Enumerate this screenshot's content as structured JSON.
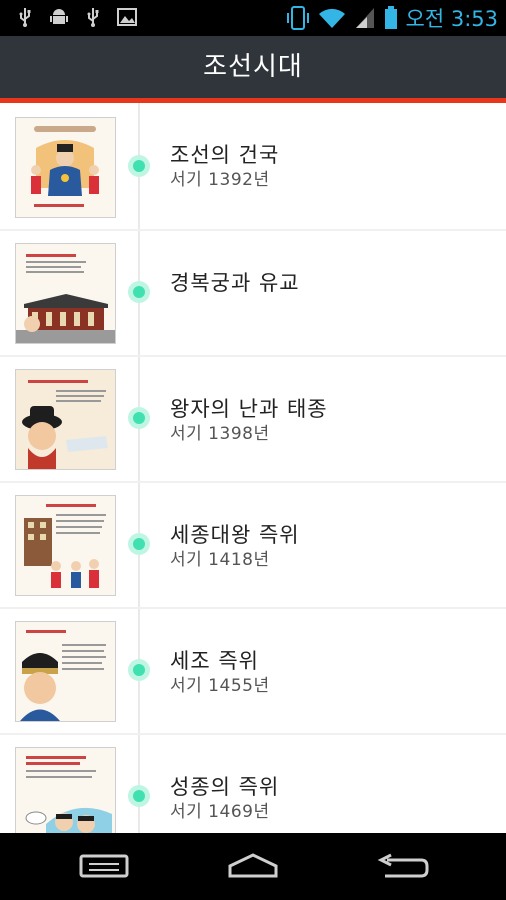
{
  "status_bar": {
    "icons": [
      "usb-icon",
      "android-debug-icon",
      "usb-icon",
      "image-icon"
    ],
    "right_icons": [
      "vibrate-icon",
      "wifi-icon",
      "signal-icon",
      "battery-icon"
    ],
    "time": "오전 3:53",
    "accent_color": "#33b5e5"
  },
  "action_bar": {
    "title": "조선시대",
    "background": "#2f353b",
    "accent_line": "#e8361c"
  },
  "timeline": {
    "dot_color": "#41e0b0",
    "items": [
      {
        "title": "조선의 건국",
        "subtitle": "서기 1392년",
        "thumb_caption": "태조 이성계"
      },
      {
        "title": "경복궁과 유교",
        "subtitle": "",
        "thumb_caption": "경복궁"
      },
      {
        "title": "왕자의 난과 태종",
        "subtitle": "서기 1398년",
        "thumb_caption": "태종"
      },
      {
        "title": "세종대왕 즉위",
        "subtitle": "서기 1418년",
        "thumb_caption": "세종"
      },
      {
        "title": "세조 즉위",
        "subtitle": "서기 1455년",
        "thumb_caption": "세조"
      },
      {
        "title": "성종의 즉위",
        "subtitle": "서기 1469년",
        "thumb_caption": "성종"
      }
    ]
  },
  "nav_bar": {
    "buttons": [
      "recent-apps-icon",
      "home-icon",
      "back-icon"
    ]
  }
}
